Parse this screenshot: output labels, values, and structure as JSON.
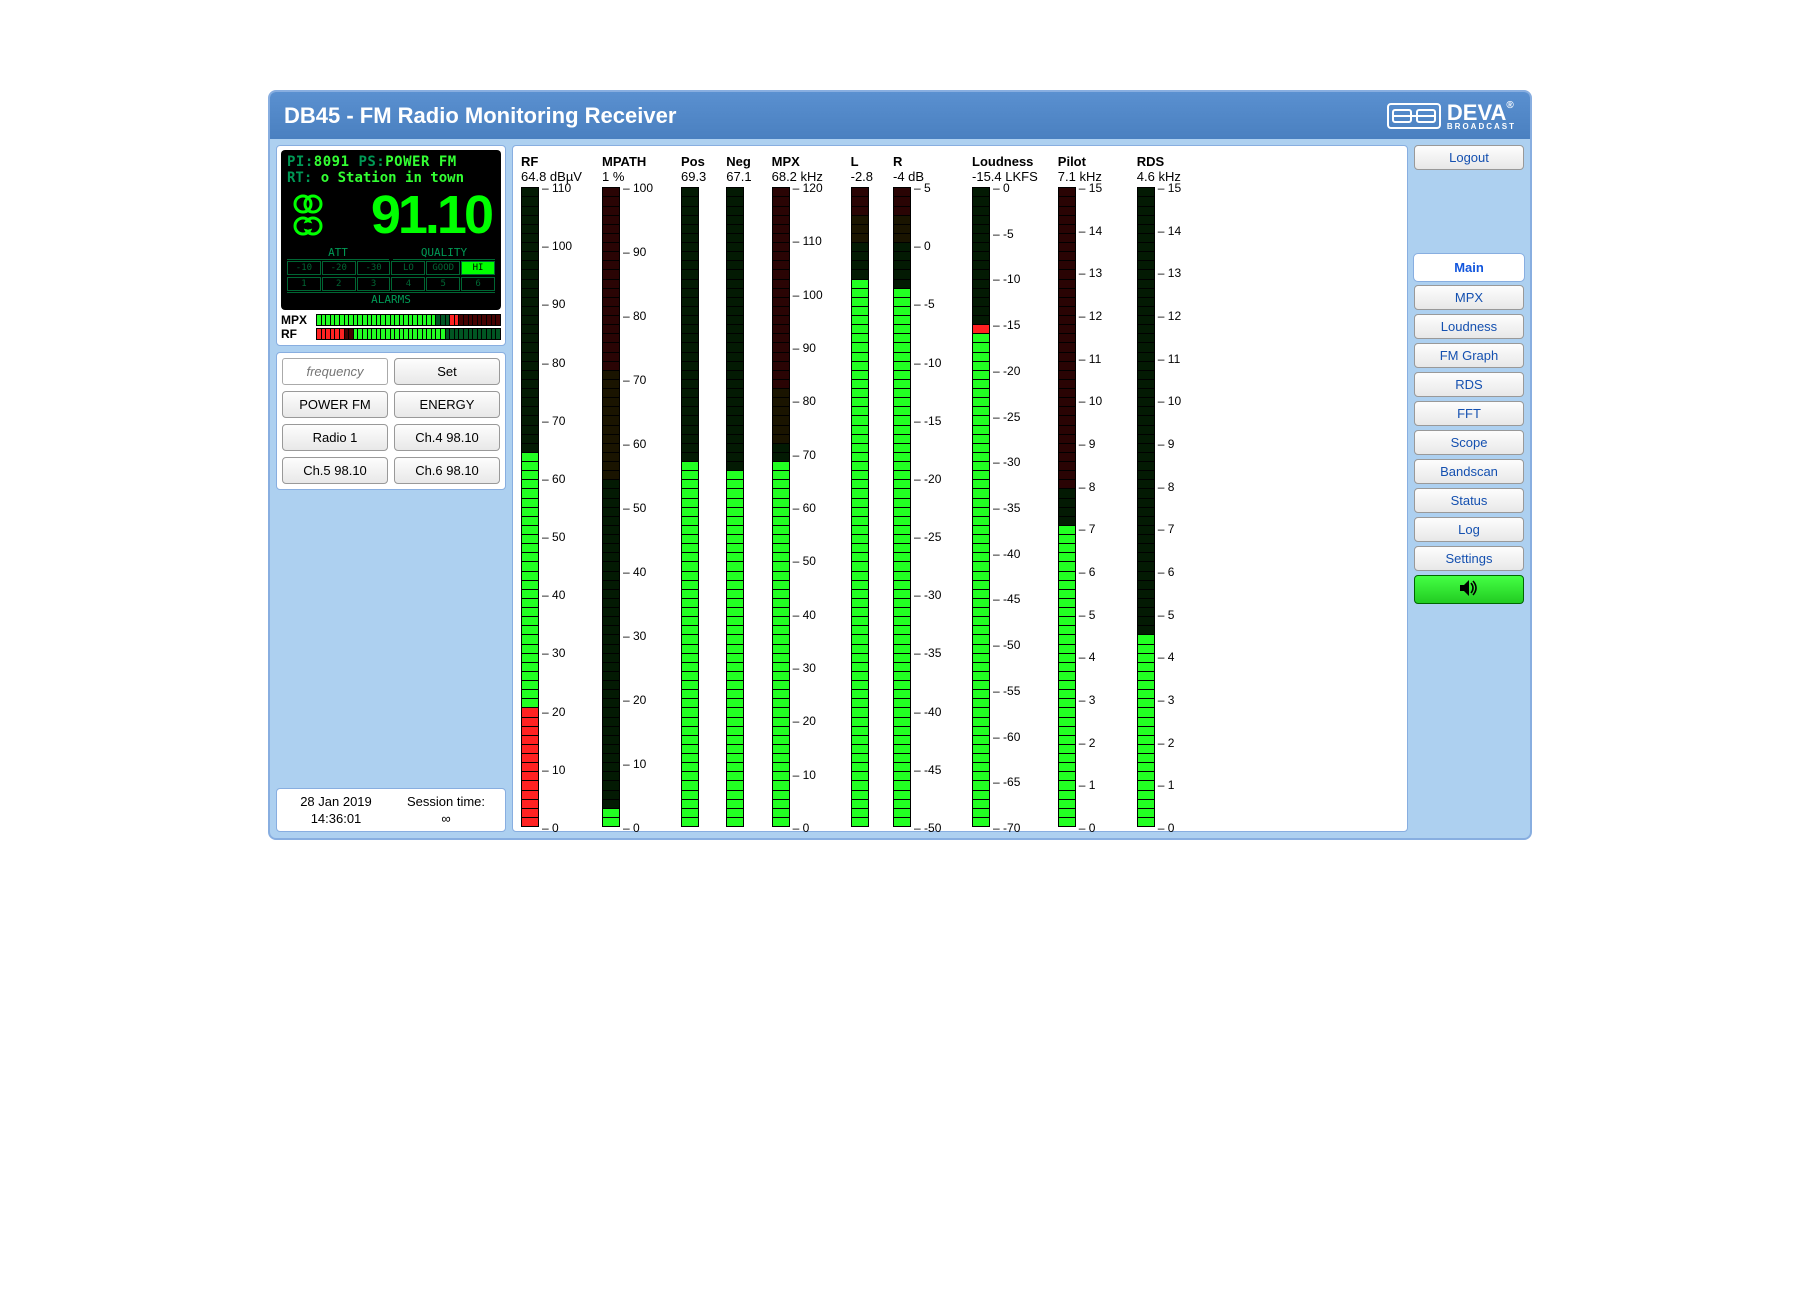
{
  "header": {
    "title": "DB45 - FM Radio Monitoring Receiver",
    "brand": "DEVA",
    "brand_sub": "BROADCAST"
  },
  "lcd": {
    "pi_label": "PI:",
    "pi": "8091",
    "ps_label": "PS:",
    "ps": "POWER FM",
    "rt_label": "RT:",
    "rt": "o Station in town",
    "freq": "91.10",
    "att_label": "ATT",
    "quality_label": "QUALITY",
    "att_cells": [
      "-10",
      "-20",
      "-30"
    ],
    "q_cells": [
      "LO",
      "GOOD",
      "HI"
    ],
    "q_hi_index": 2,
    "alarm_label": "ALARMS",
    "alarm_cells": [
      "1",
      "2",
      "3",
      "4",
      "5",
      "6"
    ]
  },
  "mini": {
    "mpx_label": "MPX",
    "rf_label": "RF"
  },
  "presets": {
    "freq_placeholder": "frequency",
    "set": "Set",
    "items": [
      "POWER FM",
      "ENERGY",
      "Radio 1",
      "Ch.4 98.10",
      "Ch.5 98.10",
      "Ch.6 98.10"
    ]
  },
  "status": {
    "date": "28 Jan 2019",
    "time": "14:36:01",
    "session_label": "Session time:",
    "session": "∞"
  },
  "nav": {
    "logout": "Logout",
    "items": [
      "Main",
      "MPX",
      "Loudness",
      "FM Graph",
      "RDS",
      "FFT",
      "Scope",
      "Bandscan",
      "Status",
      "Log",
      "Settings"
    ],
    "active": "Main"
  },
  "chart_data": [
    {
      "type": "bar",
      "name": "RF",
      "value": 64.8,
      "unit": "dBµV",
      "ylim": [
        0,
        110
      ],
      "ticks": [
        0,
        10,
        20,
        30,
        40,
        50,
        60,
        70,
        80,
        90,
        100,
        110
      ],
      "zones": [
        {
          "to": 20,
          "c": "r"
        },
        {
          "to": 65,
          "c": "g"
        },
        {
          "to": 110,
          "c": "dg"
        }
      ],
      "fill": 64.8
    },
    {
      "type": "bar",
      "name": "MPATH",
      "value": 1.0,
      "unit": "%",
      "ylim": [
        0,
        100
      ],
      "ticks": [
        0,
        10,
        20,
        30,
        40,
        50,
        60,
        70,
        80,
        90,
        100
      ],
      "zones": [
        {
          "to": 3,
          "c": "g"
        },
        {
          "to": 55,
          "c": "dg"
        },
        {
          "to": 72,
          "c": "do"
        },
        {
          "to": 100,
          "c": "dr"
        }
      ],
      "fill": 3
    },
    {
      "type": "bar",
      "name": "Pos",
      "value": 69.3,
      "unit": "",
      "ylim": [
        0,
        120
      ],
      "ticks": [],
      "zones": [
        {
          "to": 65,
          "c": "g"
        },
        {
          "to": 69,
          "c": "g"
        },
        {
          "to": 120,
          "c": "dg"
        }
      ],
      "fill": 69,
      "hide_ticks": true
    },
    {
      "type": "bar",
      "name": "Neg",
      "value": 67.1,
      "unit": "",
      "ylim": [
        0,
        120
      ],
      "ticks": [],
      "zones": [
        {
          "to": 64,
          "c": "g"
        },
        {
          "to": 67,
          "c": "g"
        },
        {
          "to": 120,
          "c": "dg"
        }
      ],
      "fill": 67,
      "hide_ticks": true
    },
    {
      "type": "bar",
      "name": "MPX",
      "value": 68.2,
      "unit": "kHz",
      "ylim": [
        0,
        120
      ],
      "ticks": [
        0,
        10,
        20,
        30,
        40,
        50,
        60,
        70,
        80,
        90,
        100,
        110,
        120
      ],
      "zones": [
        {
          "to": 68,
          "c": "g"
        },
        {
          "to": 72,
          "c": "dg"
        },
        {
          "to": 82,
          "c": "do"
        },
        {
          "to": 120,
          "c": "dr"
        }
      ],
      "fill": 68
    },
    {
      "type": "bar",
      "name": "L",
      "value": -2.8,
      "unit": "",
      "ylim": [
        -50,
        5
      ],
      "ticks": [],
      "zones": [
        {
          "to": -3,
          "c": "g"
        },
        {
          "to": 0,
          "c": "dg"
        },
        {
          "to": 3,
          "c": "do"
        },
        {
          "to": 5,
          "c": "dr"
        }
      ],
      "fill": -2.8,
      "hide_ticks": true
    },
    {
      "type": "bar",
      "name": "R",
      "value": -4.0,
      "unit": "dB",
      "ylim": [
        -50,
        5
      ],
      "ticks": [
        -50,
        -45,
        -40,
        -35,
        -30,
        -25,
        -20,
        -15,
        -10,
        -5,
        0,
        5
      ],
      "zones": [
        {
          "to": -4,
          "c": "g"
        },
        {
          "to": 0,
          "c": "dg"
        },
        {
          "to": 3,
          "c": "do"
        },
        {
          "to": 5,
          "c": "dr"
        }
      ],
      "fill": -4
    },
    {
      "type": "bar",
      "name": "Loudness",
      "value": -15.4,
      "unit": "LKFS",
      "ylim": [
        -70,
        0
      ],
      "ticks": [
        -70,
        -65,
        -60,
        -55,
        -50,
        -45,
        -40,
        -35,
        -30,
        -25,
        -20,
        -15,
        -10,
        -5,
        0
      ],
      "zones": [
        {
          "to": -16,
          "c": "g"
        },
        {
          "to": -15,
          "c": "r"
        },
        {
          "to": 0,
          "c": "dg"
        }
      ],
      "fill": -15.4
    },
    {
      "type": "bar",
      "name": "Pilot",
      "value": 7.1,
      "unit": "kHz",
      "ylim": [
        0,
        15
      ],
      "ticks": [
        0,
        1,
        2,
        3,
        4,
        5,
        6,
        7,
        8,
        9,
        10,
        11,
        12,
        13,
        14,
        15
      ],
      "zones": [
        {
          "to": 7.1,
          "c": "g"
        },
        {
          "to": 8,
          "c": "dg"
        },
        {
          "to": 15,
          "c": "dr"
        }
      ],
      "fill": 7.1
    },
    {
      "type": "bar",
      "name": "RDS",
      "value": 4.6,
      "unit": "kHz",
      "ylim": [
        0,
        15
      ],
      "ticks": [
        0,
        1,
        2,
        3,
        4,
        5,
        6,
        7,
        8,
        9,
        10,
        11,
        12,
        13,
        14,
        15
      ],
      "zones": [
        {
          "to": 4.6,
          "c": "g"
        },
        {
          "to": 8,
          "c": "dg"
        },
        {
          "to": 15,
          "c": "dg"
        }
      ],
      "fill": 4.6
    }
  ]
}
